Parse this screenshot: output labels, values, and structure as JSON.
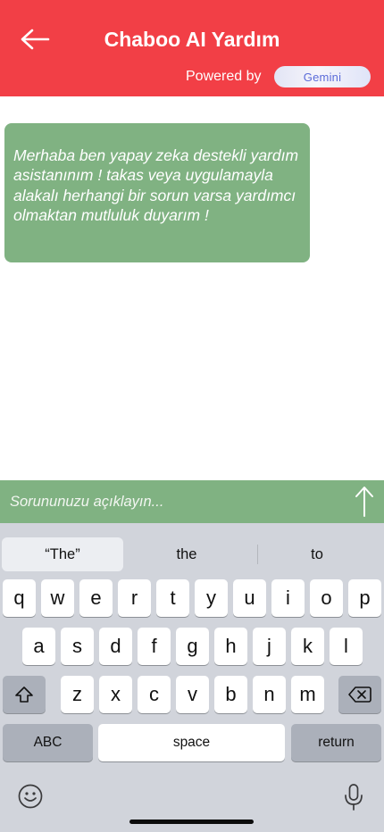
{
  "header": {
    "title": "Chaboo AI Yardım",
    "powered_by": "Powered by",
    "gemini_label": "Gemini"
  },
  "chat": {
    "messages": [
      {
        "text": "Merhaba ben yapay zeka destekli yardım asistanınım ! takas veya uygulamayla alakalı herhangi bir sorun varsa yardımcı olmaktan mutluluk duyarım !"
      }
    ]
  },
  "input": {
    "placeholder": "Sorununuzu açıklayın...",
    "value": ""
  },
  "keyboard": {
    "predictions": [
      "“The”",
      "the",
      "to"
    ],
    "row1": [
      "q",
      "w",
      "e",
      "r",
      "t",
      "y",
      "u",
      "i",
      "o",
      "p"
    ],
    "row2": [
      "a",
      "s",
      "d",
      "f",
      "g",
      "h",
      "j",
      "k",
      "l"
    ],
    "row3": [
      "z",
      "x",
      "c",
      "v",
      "b",
      "n",
      "m"
    ],
    "abc_label": "ABC",
    "space_label": "space",
    "return_label": "return"
  },
  "colors": {
    "header": "#f23f46",
    "bubble": "#80b282",
    "keyboard": "#d1d4db"
  },
  "icons": {
    "back": "arrow-left-icon",
    "send": "arrow-up-icon",
    "shift": "shift-icon",
    "delete": "backspace-icon",
    "emoji": "emoji-icon",
    "mic": "microphone-icon"
  }
}
